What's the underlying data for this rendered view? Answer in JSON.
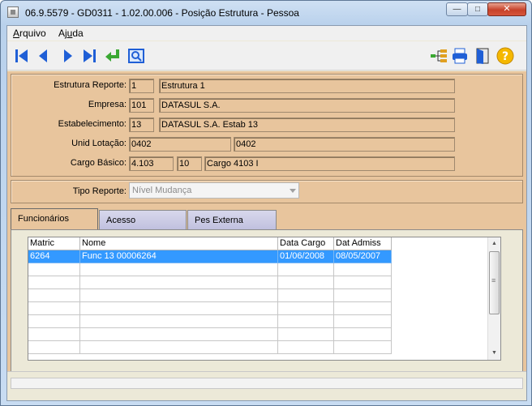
{
  "window": {
    "title": "06.9.5579 - GD0311 - 1.02.00.006 - Posição Estrutura - Pessoa",
    "minimize": "—",
    "maximize": "□",
    "close": "✕"
  },
  "menu": {
    "arquivo_first": "A",
    "arquivo_rest": "rquivo",
    "ajuda_first": "Aj",
    "ajuda_u": "u",
    "ajuda_rest": "da"
  },
  "toolbar": {
    "icons": [
      "first-record-icon",
      "previous-record-icon",
      "next-record-icon",
      "last-record-icon",
      "go-to-icon",
      "search-icon",
      "hierarchy-icon",
      "print-icon",
      "exit-icon",
      "help-icon"
    ],
    "accent_blue": "#1f5fd6",
    "accent_green": "#3aa832"
  },
  "form": {
    "estrutura_label": "Estrutura Reporte:",
    "estrutura_code": "1",
    "estrutura_desc": "Estrutura 1",
    "empresa_label": "Empresa:",
    "empresa_code": "101",
    "empresa_desc": "DATASUL S.A.",
    "estab_label": "Estabelecimento:",
    "estab_code": "13",
    "estab_desc": "DATASUL S.A. Estab 13",
    "lotacao_label": "Unid Lotação:",
    "lotacao_code": "0402",
    "lotacao_desc": "0402",
    "cargo_label": "Cargo Básico:",
    "cargo_code": "4.103",
    "cargo_sub": "10",
    "cargo_desc": "Cargo 4103 I",
    "tipo_label": "Tipo Reporte:",
    "tipo_value": "Nível Mudança"
  },
  "tabs": [
    {
      "label": "Funcionários"
    },
    {
      "label": "Acesso"
    },
    {
      "label": "Pes Externa"
    }
  ],
  "grid": {
    "columns": [
      "Matric",
      "Nome",
      "Data Cargo",
      "Dat Admiss"
    ],
    "rows": [
      [
        "6264",
        "Func 13 00006264",
        "01/06/2008",
        "08/05/2007"
      ]
    ]
  },
  "colors": {
    "form_background": "#e8c59d",
    "selection": "#3399ff"
  }
}
